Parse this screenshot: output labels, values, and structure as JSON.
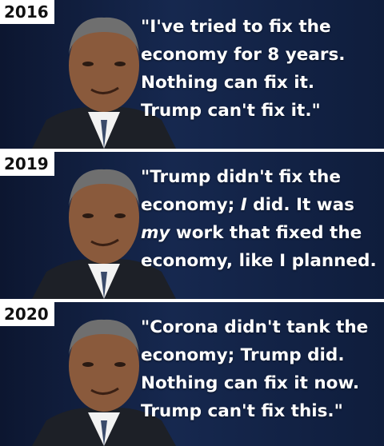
{
  "panels": [
    {
      "year": "2016",
      "quote_parts": [
        "\"I've tried to fix the\neconomy for 8 years.\nNothing can fix it.\nTrump can't fix it.\""
      ]
    },
    {
      "year": "2019",
      "quote_parts": [
        "\"Trump didn't fix the\neconomy; ",
        "I",
        " did. It was\n",
        "my",
        " work that fixed the\neconomy, like I planned."
      ]
    },
    {
      "year": "2020",
      "quote_parts": [
        "\"Corona didn't tank the\neconomy; Trump did.\nNothing can fix it now.\nTrump can't fix this.\""
      ]
    }
  ],
  "colors": {
    "background": "#16284f",
    "text": "#ffffff",
    "label_bg": "#ffffff",
    "divider": "#ffffff"
  }
}
